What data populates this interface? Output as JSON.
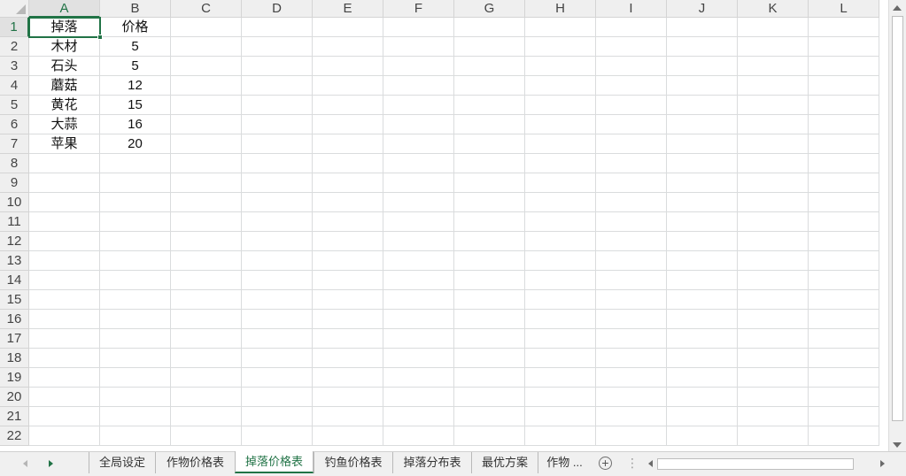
{
  "columns": [
    "A",
    "B",
    "C",
    "D",
    "E",
    "F",
    "G",
    "H",
    "I",
    "J",
    "K",
    "L"
  ],
  "rows": [
    "1",
    "2",
    "3",
    "4",
    "5",
    "6",
    "7",
    "8",
    "9",
    "10",
    "11",
    "12",
    "13",
    "14",
    "15",
    "16",
    "17",
    "18",
    "19",
    "20",
    "21",
    "22"
  ],
  "active_cell": "A1",
  "cells": [
    [
      "掉落",
      "价格"
    ],
    [
      "木材",
      "5"
    ],
    [
      "石头",
      "5"
    ],
    [
      "蘑菇",
      "12"
    ],
    [
      "黄花",
      "15"
    ],
    [
      "大蒜",
      "16"
    ],
    [
      "苹果",
      "20"
    ]
  ],
  "sheet_tabs": [
    {
      "label": "全局设定",
      "active": false
    },
    {
      "label": "作物价格表",
      "active": false
    },
    {
      "label": "掉落价格表",
      "active": true
    },
    {
      "label": "钓鱼价格表",
      "active": false
    },
    {
      "label": "掉落分布表",
      "active": false
    },
    {
      "label": "最优方案",
      "active": false
    },
    {
      "label": "作物 ...",
      "active": false
    }
  ],
  "tab_bar": {
    "add_sheet_symbol": "+",
    "more_symbol": "⋮"
  },
  "icons": {
    "nav_prev": "triangle-left-icon",
    "nav_next": "triangle-right-icon",
    "add_sheet": "plus-circle-icon",
    "more": "vertical-ellipsis-icon",
    "scroll_up": "scroll-up-arrow-icon",
    "scroll_down": "scroll-down-arrow-icon",
    "scroll_left": "scroll-left-arrow-icon",
    "scroll_right": "scroll-right-arrow-icon"
  },
  "colors": {
    "accent": "#217346",
    "header_bg": "#efefef",
    "gridline": "#dadcdd"
  }
}
